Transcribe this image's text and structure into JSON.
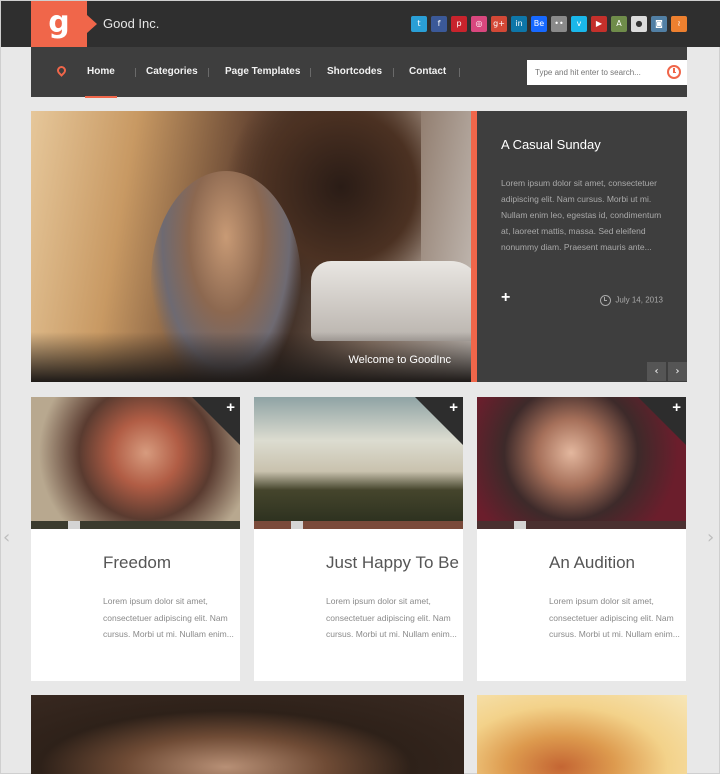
{
  "header": {
    "logo_letter": "g",
    "brand": "Good Inc.",
    "social": [
      {
        "name": "twitter-icon",
        "glyph": "t",
        "color": "#2a9fd6"
      },
      {
        "name": "facebook-icon",
        "glyph": "f",
        "color": "#3b5998"
      },
      {
        "name": "pinterest-icon",
        "glyph": "p",
        "color": "#c8232c"
      },
      {
        "name": "dribbble-icon",
        "glyph": "◎",
        "color": "#d9477e"
      },
      {
        "name": "google-plus-icon",
        "glyph": "g+",
        "color": "#d34836"
      },
      {
        "name": "linkedin-icon",
        "glyph": "in",
        "color": "#0e76a8"
      },
      {
        "name": "behance-icon",
        "glyph": "Be",
        "color": "#1769ff"
      },
      {
        "name": "flickr-icon",
        "glyph": "••",
        "color": "#8a8a8a"
      },
      {
        "name": "vimeo-icon",
        "glyph": "v",
        "color": "#1ab7ea"
      },
      {
        "name": "youtube-icon",
        "glyph": "▶",
        "color": "#c4302b"
      },
      {
        "name": "android-icon",
        "glyph": "A",
        "color": "#6f8c4a"
      },
      {
        "name": "apple-icon",
        "glyph": "●",
        "color": "#dcdcdc"
      },
      {
        "name": "instagram-icon",
        "glyph": "◙",
        "color": "#517fa4"
      },
      {
        "name": "rss-icon",
        "glyph": "≀",
        "color": "#ee802f"
      }
    ]
  },
  "nav": {
    "items": [
      "Home",
      "Categories",
      "Page Templates",
      "Shortcodes",
      "Contact"
    ],
    "search_placeholder": "Type and hit enter to search..."
  },
  "hero": {
    "caption": "Welcome to GoodInc",
    "post_title": "A Casual Sunday",
    "excerpt": "Lorem ipsum dolor sit amet, consectetuer adipiscing elit. Nam cursus. Morbi ut mi. Nullam enim leo, egestas id, condimentum at, laoreet mattis, massa. Sed eleifend nonummy diam. Praesent mauris ante...",
    "plus": "+",
    "date": "July 14, 2013",
    "prev": "‹",
    "next": "›"
  },
  "cards": [
    {
      "title": "Freedom",
      "excerpt": "Lorem ipsum dolor sit amet, consectetuer adipiscing elit. Nam cursus. Morbi ut mi. Nullam enim...",
      "plus": "+",
      "strip_color": "#3b3b2e"
    },
    {
      "title": "Just Happy To Be",
      "excerpt": "Lorem ipsum dolor sit amet, consectetuer adipiscing elit. Nam cursus. Morbi ut mi. Nullam enim...",
      "plus": "+",
      "strip_color": "#7a4a3a"
    },
    {
      "title": "An Audition",
      "excerpt": "Lorem ipsum dolor sit amet, consectetuer adipiscing elit. Nam cursus. Morbi ut mi. Nullam enim...",
      "plus": "+",
      "strip_color": "#4a3030"
    }
  ],
  "carousel": {
    "left": "‹",
    "right": "›"
  },
  "accent_color": "#f0664a"
}
